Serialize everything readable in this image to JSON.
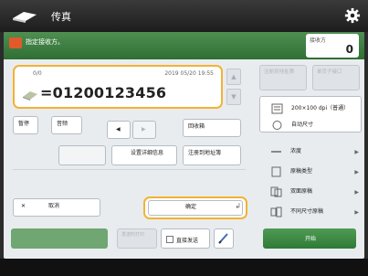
{
  "header": {
    "title": "传真",
    "settings_icon": "gear-icon"
  },
  "greenbar": {
    "specify_label": "指定接收方。"
  },
  "counter": {
    "label": "接收方",
    "value": "0"
  },
  "destination": {
    "count": "0/0",
    "datetime": "2019 05/20 19:55",
    "number": "=01200123456"
  },
  "buttons": {
    "pause": "暂停",
    "tone": "音频",
    "backspace": "回收箱",
    "left_arrow": "◀",
    "right_arrow": "▶",
    "set_sub": "设置详细信息",
    "register_subject": "注册到地址簿",
    "delete_icon": "✕",
    "cancel": "取消",
    "ok": "确定",
    "enter": "↲"
  },
  "right_panel": {
    "top_left": "注册到地址簿",
    "top_right": "单页子接口",
    "resolution": "200×100 dpi（普通）",
    "auto_size": "自动尺寸",
    "density": "浓度",
    "original_type": "原稿类型",
    "duplex": "双面原稿",
    "mixed_sizes": "不同尺寸原稿"
  },
  "bottom": {
    "display": "",
    "direct_send": "发送时打印",
    "check_label": "直接发送",
    "start": "开始"
  },
  "colors": {
    "accent": "#f2b233",
    "brand_green": "#3c7f41"
  }
}
